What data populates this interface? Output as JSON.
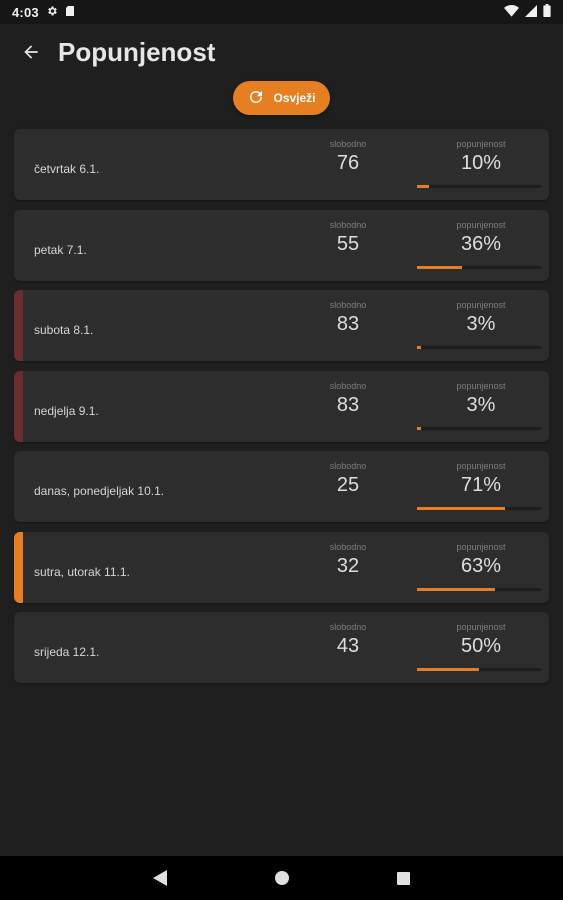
{
  "status": {
    "time": "4:03"
  },
  "header": {
    "title": "Popunjenost"
  },
  "toolbar": {
    "refresh_label": "Osvježi"
  },
  "labels": {
    "free": "slobodno",
    "occupancy": "popunjenost"
  },
  "days": [
    {
      "date": "četvrtak 6.1.",
      "free": "76",
      "occupancy": "10%",
      "occupancy_fraction": 0.1,
      "accent": "none"
    },
    {
      "date": "petak 7.1.",
      "free": "55",
      "occupancy": "36%",
      "occupancy_fraction": 0.36,
      "accent": "none"
    },
    {
      "date": "subota 8.1.",
      "free": "83",
      "occupancy": "3%",
      "occupancy_fraction": 0.03,
      "accent": "red"
    },
    {
      "date": "nedjelja 9.1.",
      "free": "83",
      "occupancy": "3%",
      "occupancy_fraction": 0.03,
      "accent": "red"
    },
    {
      "date": "danas, ponedjeljak 10.1.",
      "free": "25",
      "occupancy": "71%",
      "occupancy_fraction": 0.71,
      "accent": "none"
    },
    {
      "date": "sutra, utorak 11.1.",
      "free": "32",
      "occupancy": "63%",
      "occupancy_fraction": 0.63,
      "accent": "orange"
    },
    {
      "date": "srijeda 12.1.",
      "free": "43",
      "occupancy": "50%",
      "occupancy_fraction": 0.5,
      "accent": "none"
    }
  ],
  "colors": {
    "accent": "#e67e22",
    "weekend": "#6b2e2e",
    "card": "#2d2d2d",
    "background": "#1f1f1f"
  },
  "icons": {
    "status": [
      "gear-icon",
      "sd-card-icon",
      "wifi-icon",
      "signal-icon",
      "battery-icon"
    ],
    "app": [
      "back-arrow-icon",
      "refresh-icon"
    ],
    "nav": [
      "nav-back-icon",
      "nav-home-icon",
      "nav-recents-icon"
    ]
  }
}
